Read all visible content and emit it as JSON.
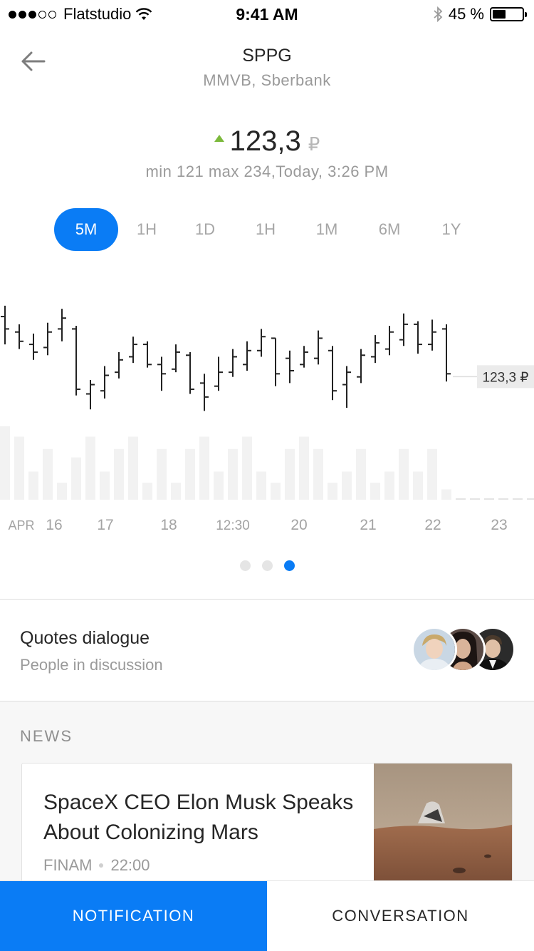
{
  "status_bar": {
    "carrier": "Flatstudio",
    "time": "9:41 AM",
    "battery": "45 %",
    "battery_level": 0.45
  },
  "header": {
    "ticker": "SPPG",
    "exchange": "MMVB, Sberbank"
  },
  "price": {
    "value": "123,3",
    "currency": "₽",
    "trend": "up",
    "info": "min 121 max 234,Today, 3:26 PM"
  },
  "periods": [
    {
      "label": "5M",
      "active": true
    },
    {
      "label": "1H",
      "active": false
    },
    {
      "label": "1D",
      "active": false
    },
    {
      "label": "1H",
      "active": false
    },
    {
      "label": "1M",
      "active": false
    },
    {
      "label": "6M",
      "active": false
    },
    {
      "label": "1Y",
      "active": false
    }
  ],
  "chart_data": {
    "type": "ohlc",
    "price_tag": "123,3 ₽",
    "last_price": 123.3,
    "x_tick_labels": [
      "APR",
      "16",
      "17",
      "18",
      "12:30",
      "20",
      "21",
      "22",
      "23"
    ],
    "bars": [
      {
        "high": 0.95,
        "low": 0.7,
        "open": 0.88,
        "close": 0.8
      },
      {
        "high": 0.83,
        "low": 0.67,
        "open": 0.78,
        "close": 0.72
      },
      {
        "high": 0.77,
        "low": 0.6,
        "open": 0.7,
        "close": 0.65
      },
      {
        "high": 0.84,
        "low": 0.63,
        "open": 0.68,
        "close": 0.78
      },
      {
        "high": 0.93,
        "low": 0.72,
        "open": 0.8,
        "close": 0.87
      },
      {
        "high": 0.82,
        "low": 0.37,
        "open": 0.8,
        "close": 0.41
      },
      {
        "high": 0.47,
        "low": 0.28,
        "open": 0.38,
        "close": 0.44
      },
      {
        "high": 0.56,
        "low": 0.35,
        "open": 0.4,
        "close": 0.5
      },
      {
        "high": 0.65,
        "low": 0.48,
        "open": 0.52,
        "close": 0.6
      },
      {
        "high": 0.75,
        "low": 0.58,
        "open": 0.62,
        "close": 0.7
      },
      {
        "high": 0.72,
        "low": 0.55,
        "open": 0.7,
        "close": 0.57
      },
      {
        "high": 0.62,
        "low": 0.4,
        "open": 0.57,
        "close": 0.51
      },
      {
        "high": 0.7,
        "low": 0.52,
        "open": 0.54,
        "close": 0.65
      },
      {
        "high": 0.65,
        "low": 0.38,
        "open": 0.63,
        "close": 0.41
      },
      {
        "high": 0.51,
        "low": 0.27,
        "open": 0.45,
        "close": 0.36
      },
      {
        "high": 0.62,
        "low": 0.4,
        "open": 0.43,
        "close": 0.52
      },
      {
        "high": 0.67,
        "low": 0.49,
        "open": 0.52,
        "close": 0.62
      },
      {
        "high": 0.72,
        "low": 0.53,
        "open": 0.57,
        "close": 0.66
      },
      {
        "high": 0.8,
        "low": 0.62,
        "open": 0.66,
        "close": 0.75
      },
      {
        "high": 0.74,
        "low": 0.43,
        "open": 0.74,
        "close": 0.51
      },
      {
        "high": 0.66,
        "low": 0.45,
        "open": 0.61,
        "close": 0.53
      },
      {
        "high": 0.69,
        "low": 0.55,
        "open": 0.57,
        "close": 0.65
      },
      {
        "high": 0.79,
        "low": 0.57,
        "open": 0.61,
        "close": 0.74
      },
      {
        "high": 0.69,
        "low": 0.34,
        "open": 0.66,
        "close": 0.4
      },
      {
        "high": 0.56,
        "low": 0.29,
        "open": 0.44,
        "close": 0.52
      },
      {
        "high": 0.67,
        "low": 0.45,
        "open": 0.49,
        "close": 0.63
      },
      {
        "high": 0.76,
        "low": 0.58,
        "open": 0.62,
        "close": 0.71
      },
      {
        "high": 0.82,
        "low": 0.63,
        "open": 0.67,
        "close": 0.78
      },
      {
        "high": 0.9,
        "low": 0.69,
        "open": 0.73,
        "close": 0.83
      },
      {
        "high": 0.85,
        "low": 0.64,
        "open": 0.83,
        "close": 0.7
      },
      {
        "high": 0.86,
        "low": 0.66,
        "open": 0.7,
        "close": 0.78
      },
      {
        "high": 0.83,
        "low": 0.46,
        "open": 0.8,
        "close": 0.51
      }
    ],
    "volumes": [
      0.78,
      0.67,
      0.3,
      0.54,
      0.18,
      0.45,
      0.67,
      0.3,
      0.54,
      0.67,
      0.18,
      0.54,
      0.18,
      0.54,
      0.67,
      0.3,
      0.54,
      0.67,
      0.3,
      0.18,
      0.54,
      0.67,
      0.54,
      0.18,
      0.3,
      0.54,
      0.18,
      0.3,
      0.54,
      0.3,
      0.54,
      0.11
    ]
  },
  "pager": {
    "count": 3,
    "active": 2
  },
  "discussion": {
    "title": "Quotes dialogue",
    "subtitle": "People in discussion",
    "participants": [
      "avatar-1",
      "avatar-2",
      "avatar-3"
    ]
  },
  "news": {
    "section_label": "NEWS",
    "items": [
      {
        "title": "SpaceX CEO Elon Musk Speaks About Colonizing Mars",
        "source": "FINAM",
        "time": "22:00"
      }
    ]
  },
  "bottom_bar": {
    "primary_label": "NOTIFICATION",
    "secondary_label": "CONVERSATION"
  },
  "colors": {
    "accent": "#0a7cf5",
    "up": "#7cb93c",
    "candle": "#222222",
    "volume": "#f2f2f2"
  }
}
